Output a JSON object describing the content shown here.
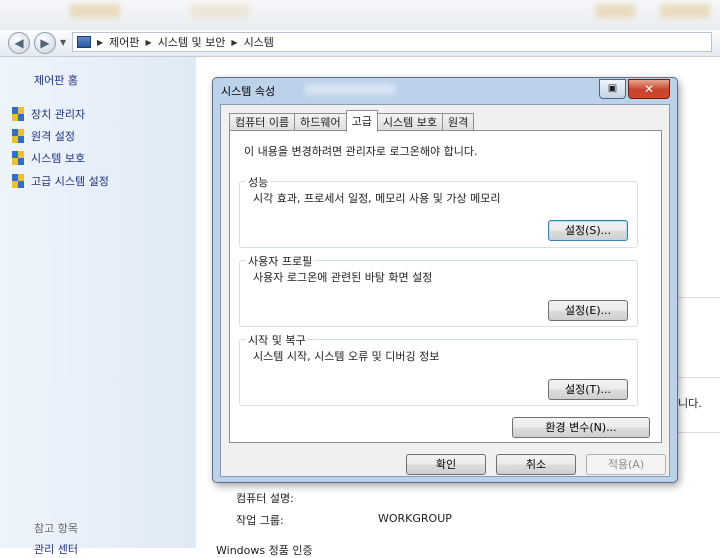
{
  "address": {
    "crumbs": [
      "제어판",
      "시스템 및 보안",
      "시스템"
    ]
  },
  "left_pane": {
    "home": "제어판 홈",
    "items": [
      "장치 관리자",
      "원격 설정",
      "시스템 보호",
      "고급 시스템 설정"
    ],
    "see_also": "참고 항목",
    "bottom_link": "관리 센터"
  },
  "main": {
    "computer_description_label": "컴퓨터 설명:",
    "workgroup_label": "작업 그룹:",
    "workgroup_value": "WORKGROUP",
    "windows_activation": "Windows 정품 인증",
    "right_fragment": "니다."
  },
  "dialog": {
    "title": "시스템 속성",
    "close_symbol": "✕",
    "tabs": [
      "컴퓨터 이름",
      "하드웨어",
      "고급",
      "시스템 보호",
      "원격"
    ],
    "active_tab": 2,
    "admin_note": "이 내용을 변경하려면 관리자로 로그온해야 합니다.",
    "groups": [
      {
        "label": "성능",
        "desc": "시각 효과, 프로세서 일정, 메모리 사용 및 가상 메모리",
        "button": "설정(S)..."
      },
      {
        "label": "사용자 프로필",
        "desc": "사용자 로그온에 관련된 바탕 화면 설정",
        "button": "설정(E)..."
      },
      {
        "label": "시작 및 복구",
        "desc": "시스템 시작, 시스템 오류 및 디버깅 정보",
        "button": "설정(T)..."
      }
    ],
    "env_button": "환경 변수(N)...",
    "ok_button": "확인",
    "cancel_button": "취소",
    "apply_button": "적용(A)"
  }
}
